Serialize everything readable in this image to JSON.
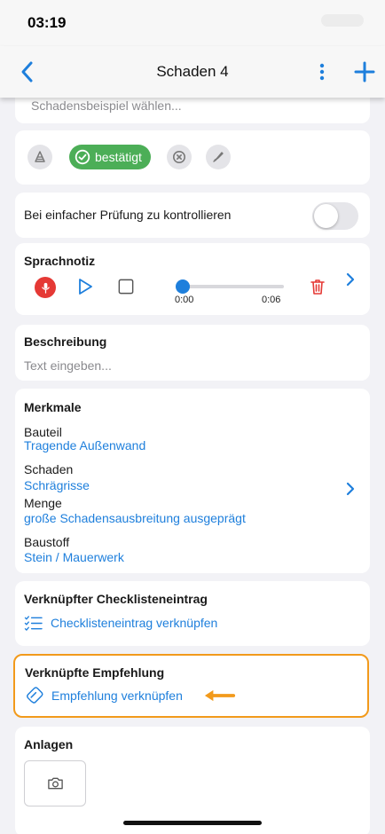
{
  "status_bar": {
    "time": "03:19"
  },
  "nav": {
    "title": "Schaden 4"
  },
  "example": {
    "placeholder": "Schadensbeispiel wählen..."
  },
  "status_chip": {
    "label": "bestätigt"
  },
  "simple_check": {
    "label": "Bei einfacher Prüfung zu kontrollieren",
    "enabled": false
  },
  "voice_note": {
    "title": "Sprachnotiz",
    "elapsed": "0:00",
    "duration": "0:06",
    "progress": 0
  },
  "description": {
    "title": "Beschreibung",
    "placeholder": "Text eingeben..."
  },
  "features": {
    "title": "Merkmale",
    "items": [
      {
        "label": "Bauteil",
        "value": "Tragende Außenwand"
      },
      {
        "label": "Schaden",
        "value": "Schrägrisse"
      },
      {
        "label": "Menge",
        "value": "große Schadensausbreitung ausgeprägt"
      },
      {
        "label": "Baustoff",
        "value": "Stein / Mauerwerk"
      }
    ]
  },
  "checklist": {
    "title": "Verknüpfter Checklisteneintrag",
    "link_label": "Checklisteneintrag verknüpfen"
  },
  "recommendation": {
    "title": "Verknüpfte Empfehlung",
    "link_label": "Empfehlung verknüpfen"
  },
  "attachments": {
    "title": "Anlagen"
  },
  "colors": {
    "accent": "#1e7fdc",
    "confirmed": "#4cae57",
    "record": "#e53935",
    "highlight": "#f29a1b"
  }
}
